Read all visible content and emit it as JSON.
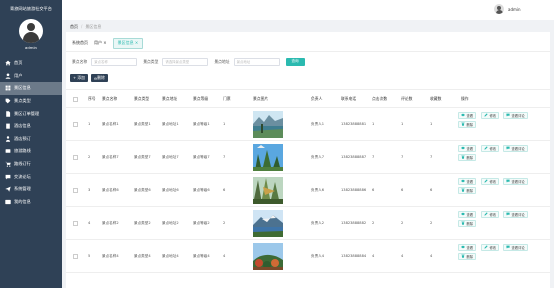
{
  "app": {
    "title": "青旅网站旅游社交平台",
    "admin_name": "admin"
  },
  "sidebar": {
    "items": [
      {
        "label": "首页",
        "icon": "home-icon"
      },
      {
        "label": "用户",
        "icon": "user-icon"
      },
      {
        "label": "景区信息",
        "icon": "grid-icon",
        "active": true
      },
      {
        "label": "景点类型",
        "icon": "tag-icon"
      },
      {
        "label": "景区订单管理",
        "icon": "document-icon"
      },
      {
        "label": "酒店信息",
        "icon": "building-icon"
      },
      {
        "label": "酒店预订",
        "icon": "person-icon"
      },
      {
        "label": "旅游路线",
        "icon": "route-icon"
      },
      {
        "label": "路线订行",
        "icon": "cart-icon"
      },
      {
        "label": "交流论坛",
        "icon": "chat-icon"
      },
      {
        "label": "系统管理",
        "icon": "send-icon"
      },
      {
        "label": "我的信息",
        "icon": "profile-icon"
      }
    ]
  },
  "header": {
    "user": "admin"
  },
  "breadcrumb": {
    "home": "首页",
    "current": "景区信息"
  },
  "tabs": {
    "items": [
      "系统首页",
      "用户",
      "景区信息"
    ]
  },
  "search": {
    "field1_label": "景点名称",
    "field1_placeholder": "景点名称",
    "field2_label": "景点类型",
    "field2_placeholder": "请选择景点类型",
    "field3_label": "景点地址",
    "field3_placeholder": "景点地址",
    "button": "查询"
  },
  "toolbar": {
    "add": "+ 添加",
    "delete": "删除"
  },
  "table": {
    "headers": [
      "序号",
      "景点名称",
      "景点类型",
      "景点地址",
      "景点等级",
      "门票",
      "景点图片",
      "负责人",
      "联系电话",
      "点击次数",
      "评论数",
      "收藏数",
      "操作"
    ],
    "rows": [
      [
        "1",
        "景点名称1",
        "景点类型1",
        "景点地址1",
        "景点等级1",
        "1",
        "负责人1",
        "13823888881",
        "1",
        "1",
        "1"
      ],
      [
        "2",
        "景点名称7",
        "景点类型7",
        "景点地址7",
        "景点等级7",
        "7",
        "负责人7",
        "13823888887",
        "7",
        "7",
        "7"
      ],
      [
        "3",
        "景点名称6",
        "景点类型6",
        "景点地址6",
        "景点等级6",
        "6",
        "负责人6",
        "13823888886",
        "6",
        "6",
        "6"
      ],
      [
        "4",
        "景点名称2",
        "景点类型2",
        "景点地址2",
        "景点等级2",
        "2",
        "负责人2",
        "13823888882",
        "2",
        "2",
        "2"
      ],
      [
        "5",
        "景点名称4",
        "景点类型4",
        "景点地址4",
        "景点等级4",
        "4",
        "负责人4",
        "13823888884",
        "4",
        "4",
        "4"
      ]
    ],
    "ops": {
      "view": "查看",
      "edit": "修改",
      "review": "查看评论",
      "delete": "删除"
    }
  },
  "colors": {
    "sidebar": "#2f4156",
    "accent": "#2bbab0",
    "active_menu": "#6c7a89"
  }
}
